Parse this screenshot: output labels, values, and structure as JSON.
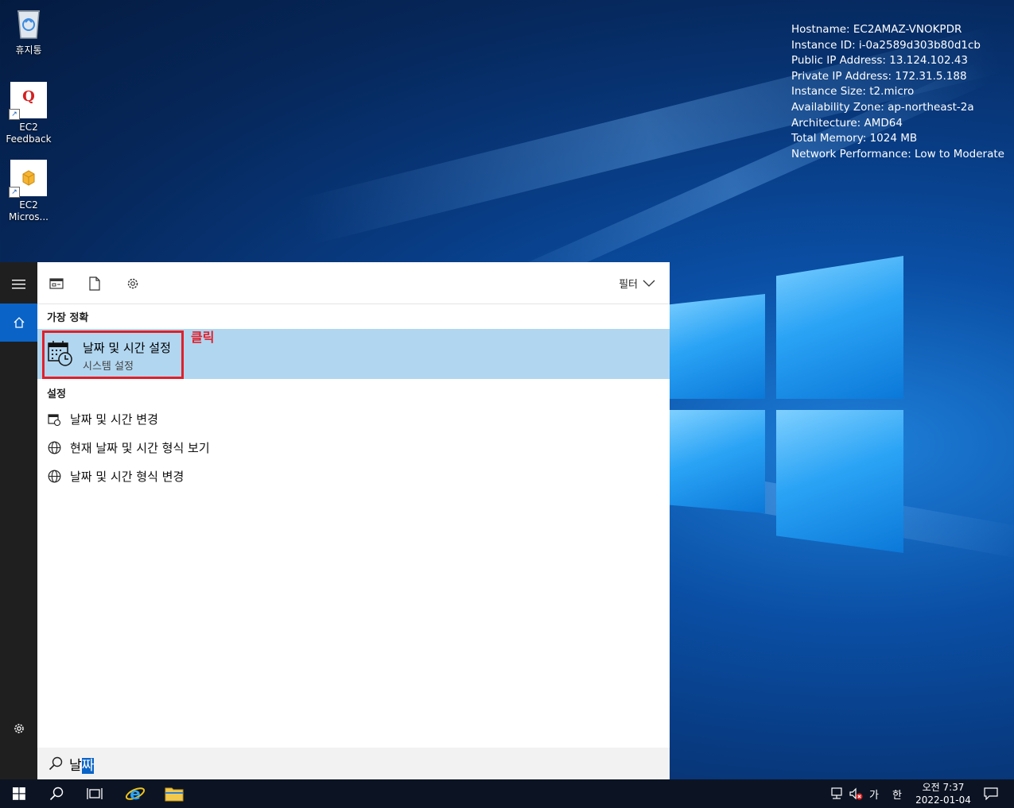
{
  "desktop": {
    "icons": [
      {
        "label": "휴지통"
      },
      {
        "label": "EC2 Feedback"
      },
      {
        "label": "EC2 Micros..."
      }
    ],
    "sysinfo": [
      "Hostname: EC2AMAZ-VNOKPDR",
      "Instance ID: i-0a2589d303b80d1cb",
      "Public IP Address: 13.124.102.43",
      "Private IP Address: 172.31.5.188",
      "Instance Size: t2.micro",
      "Availability Zone: ap-northeast-2a",
      "Architecture: AMD64",
      "Total Memory: 1024 MB",
      "Network Performance: Low to Moderate"
    ]
  },
  "search_panel": {
    "filter_label": "필터",
    "best_match_heading": "가장 정확",
    "best_match": {
      "title": "날짜 및 시간 설정",
      "subtitle": "시스템 설정",
      "annotation": "클릭"
    },
    "settings_heading": "설정",
    "settings_results": [
      "날짜 및 시간 변경",
      "현재 날짜 및 시간 형식 보기",
      "날짜 및 시간 형식 변경"
    ],
    "query_typed": "날",
    "query_selected": "짜"
  },
  "taskbar": {
    "ime_mode": "가",
    "ime_lang": "한",
    "time": "오전 7:37",
    "date": "2022-01-04"
  },
  "colors": {
    "accent": "#0a64c8",
    "highlight_row": "#b1d6f0",
    "annotation_red": "#e0202a"
  }
}
